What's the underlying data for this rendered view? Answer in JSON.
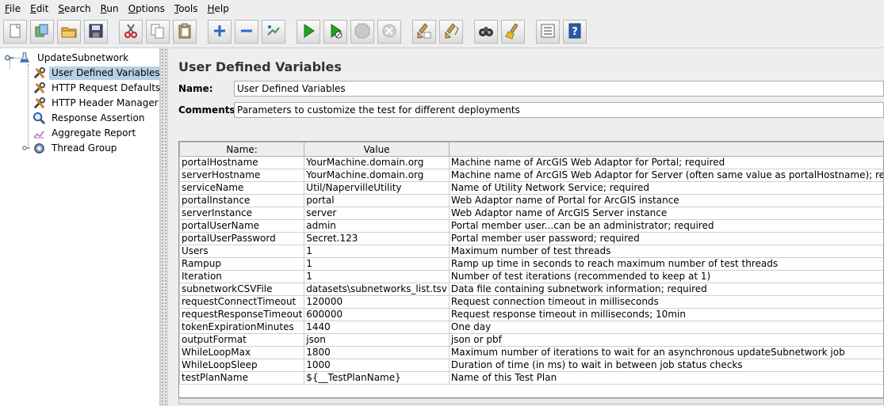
{
  "menu": {
    "items": [
      {
        "label": "File",
        "mnemonic": "F",
        "rest": "ile"
      },
      {
        "label": "Edit",
        "mnemonic": "E",
        "rest": "dit"
      },
      {
        "label": "Search",
        "mnemonic": "S",
        "rest": "earch"
      },
      {
        "label": "Run",
        "mnemonic": "R",
        "rest": "un"
      },
      {
        "label": "Options",
        "mnemonic": "O",
        "rest": "ptions"
      },
      {
        "label": "Tools",
        "mnemonic": "T",
        "rest": "ools"
      },
      {
        "label": "Help",
        "mnemonic": "H",
        "rest": "elp"
      }
    ]
  },
  "toolbar": {
    "buttons": [
      {
        "icon": "new-icon"
      },
      {
        "icon": "templates-icon"
      },
      {
        "icon": "open-icon"
      },
      {
        "icon": "save-icon"
      },
      {
        "icon": "cut-icon"
      },
      {
        "icon": "copy-icon"
      },
      {
        "icon": "paste-icon"
      },
      {
        "icon": "expand-icon"
      },
      {
        "icon": "collapse-icon"
      },
      {
        "icon": "toggle-icon"
      },
      {
        "icon": "start-icon"
      },
      {
        "icon": "start-no-pauses-icon"
      },
      {
        "icon": "stop-icon"
      },
      {
        "icon": "shutdown-icon"
      },
      {
        "icon": "clear-icon"
      },
      {
        "icon": "clear-all-icon"
      },
      {
        "icon": "search-icon"
      },
      {
        "icon": "reset-search-icon"
      },
      {
        "icon": "function-helper-icon"
      },
      {
        "icon": "help-icon"
      }
    ]
  },
  "tree": {
    "root": "UpdateSubnetwork",
    "children": [
      {
        "label": "User Defined Variables",
        "icon": "wrench-icon",
        "selected": true
      },
      {
        "label": "HTTP Request Defaults",
        "icon": "wrench-icon"
      },
      {
        "label": "HTTP Header Manager",
        "icon": "wrench-icon"
      },
      {
        "label": "Response Assertion",
        "icon": "magnifier-icon"
      },
      {
        "label": "Aggregate Report",
        "icon": "report-icon"
      },
      {
        "label": "Thread Group",
        "icon": "gear-icon"
      }
    ]
  },
  "panel": {
    "title": "User Defined Variables",
    "name_label": "Name:",
    "name_value": "User Defined Variables",
    "comments_label": "Comments:",
    "comments_value": "Parameters to customize the test for different deployments"
  },
  "table": {
    "headers": [
      "Name:",
      "Value",
      ""
    ],
    "rows": [
      [
        "portalHostname",
        "YourMachine.domain.org",
        "Machine name of ArcGIS Web Adaptor for Portal; required"
      ],
      [
        "serverHostname",
        "YourMachine.domain.org",
        "Machine name of ArcGIS Web Adaptor for Server (often same value as portalHostname); required"
      ],
      [
        "serviceName",
        "Util/NapervilleUtility",
        "Name of Utility Network Service; required"
      ],
      [
        "portalInstance",
        "portal",
        "Web Adaptor name of Portal for ArcGIS instance"
      ],
      [
        "serverInstance",
        "server",
        "Web Adaptor name of ArcGIS Server instance"
      ],
      [
        "portalUserName",
        "admin",
        "Portal member user...can be an administrator; required"
      ],
      [
        "portalUserPassword",
        "Secret.123",
        "Portal member user password; required"
      ],
      [
        "Users",
        "1",
        "Maximum number of test threads"
      ],
      [
        "Rampup",
        "1",
        "Ramp up time in seconds to reach maximum number of test threads"
      ],
      [
        "Iteration",
        "1",
        "Number of test iterations (recommended to keep at 1)"
      ],
      [
        "subnetworkCSVFile",
        "datasets\\subnetworks_list.tsv",
        "Data file containing subnetwork information; required"
      ],
      [
        "requestConnectTimeout",
        "120000",
        "Request connection timeout in milliseconds"
      ],
      [
        "requestResponseTimeout",
        "600000",
        "Request response timeout in milliseconds; 10min"
      ],
      [
        "tokenExpirationMinutes",
        "1440",
        "One day"
      ],
      [
        "outputFormat",
        "json",
        "json or pbf"
      ],
      [
        "WhileLoopMax",
        "1800",
        "Maximum number of iterations to wait for an asynchronous updateSubnetwork job"
      ],
      [
        "WhileLoopSleep",
        "1000",
        "Duration of time (in ms) to wait in between job status checks"
      ],
      [
        "testPlanName",
        "${__TestPlanName}",
        "Name of this Test Plan"
      ]
    ]
  }
}
